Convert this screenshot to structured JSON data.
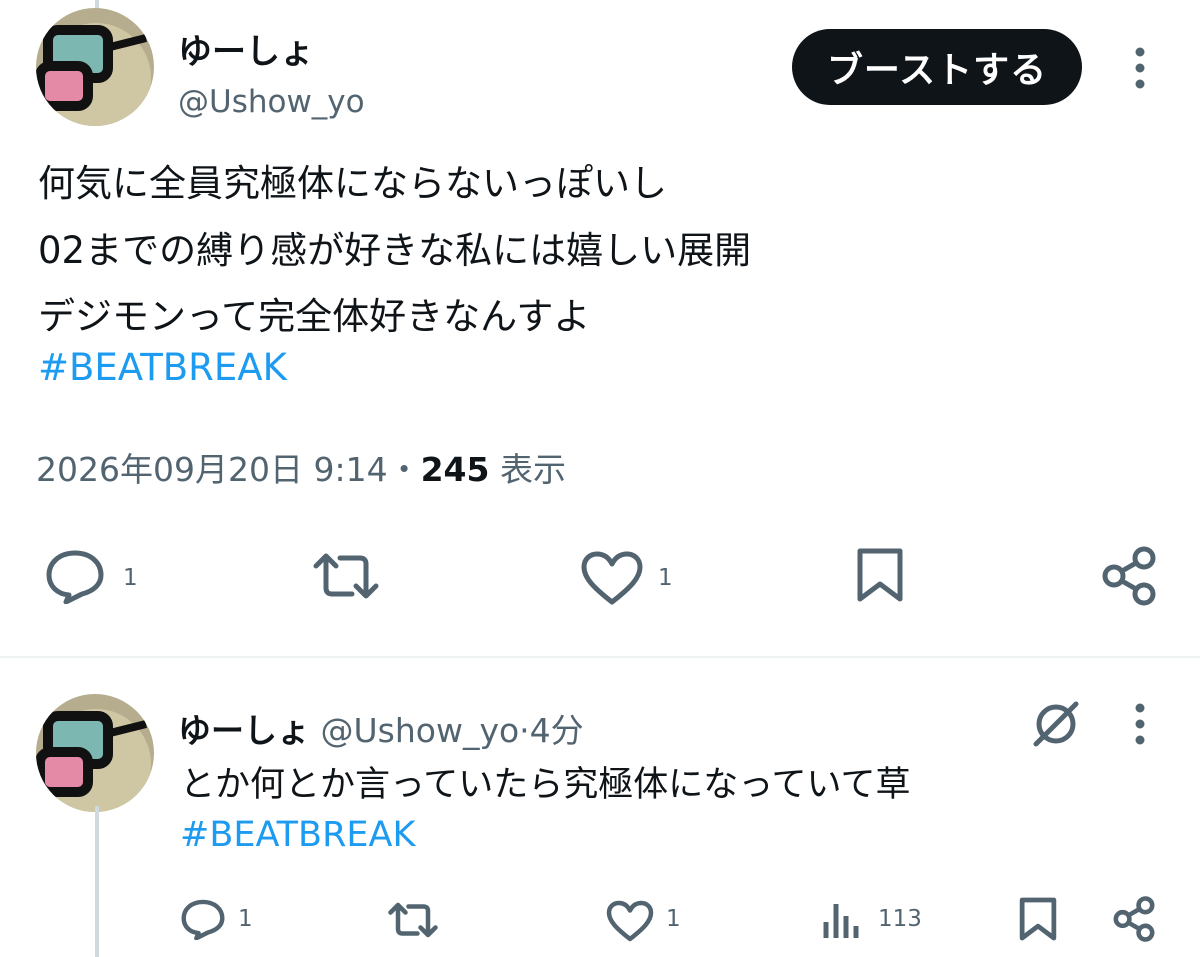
{
  "main_post": {
    "display_name": "ゆーしょ",
    "handle": "@Ushow_yo",
    "boost_label": "ブーストする",
    "body_lines": [
      "何気に全員究極体にならないっぽいし",
      "02までの縛り感が好きな私には嬉しい展開",
      "デジモンって完全体好きなんすよ"
    ],
    "hashtag": "#BEATBREAK",
    "timestamp": "2026年09月20日 9:14",
    "separator": "・",
    "views_count": "245",
    "views_label": "表示",
    "actions": {
      "reply_count": "1",
      "repost_count": "",
      "like_count": "1"
    }
  },
  "reply_post": {
    "display_name": "ゆーしょ",
    "handle": "@Ushow_yo",
    "separator": "·",
    "time_ago": "4分",
    "text": "とか何とか言っていたら究極体になっていて草",
    "hashtag": "#BEATBREAK",
    "actions": {
      "reply_count": "1",
      "like_count": "1",
      "views_count": "113"
    }
  },
  "icons": {
    "reply": "speech-bubble-icon",
    "repost": "retweet-arrows-icon",
    "like": "heart-icon",
    "bookmark": "bookmark-icon",
    "share": "share-icon",
    "views": "bar-chart-icon",
    "more": "vertical-dots-icon",
    "grok": "slashed-circle-icon"
  },
  "colors": {
    "text": "#0f1419",
    "secondary": "#536471",
    "link": "#1d9bf0",
    "button_bg": "#0f1419",
    "divider": "#eff3f4"
  }
}
